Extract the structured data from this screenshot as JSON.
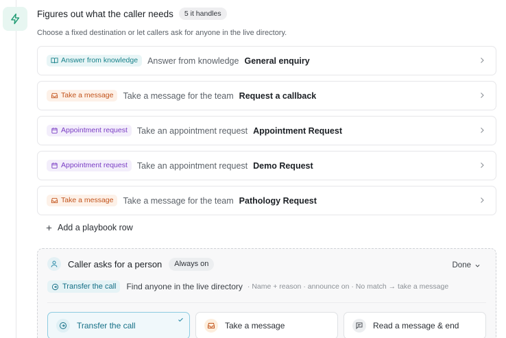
{
  "step": {
    "icon": "lightning-icon",
    "title": "Figures out what the caller needs",
    "handles_badge": "5 it handles",
    "subtitle": "Choose a fixed destination or let callers ask for anyone in the live directory."
  },
  "playbook_rows": [
    {
      "badge": "Answer from knowledge",
      "badge_icon": "book-icon",
      "tone": "teal",
      "description": "Answer from knowledge",
      "name": "General enquiry"
    },
    {
      "badge": "Take a message",
      "badge_icon": "inbox-icon",
      "tone": "orange",
      "description": "Take a message for the team",
      "name": "Request a callback"
    },
    {
      "badge": "Appointment request",
      "badge_icon": "calendar-icon",
      "tone": "purple",
      "description": "Take an appointment request",
      "name": "Appointment Request"
    },
    {
      "badge": "Appointment request",
      "badge_icon": "calendar-icon",
      "tone": "purple",
      "description": "Take an appointment request",
      "name": "Demo Request"
    },
    {
      "badge": "Take a message",
      "badge_icon": "inbox-icon",
      "tone": "orange",
      "description": "Take a message for the team",
      "name": "Pathology Request"
    }
  ],
  "add_row_label": "Add a playbook row",
  "person": {
    "title": "Caller asks for a person",
    "status_badge": "Always on",
    "done_label": "Done",
    "transfer_badge": "Transfer the call",
    "transfer_desc": "Find anyone in the live directory",
    "meta": "· Name + reason · announce on · No match → take a message",
    "options": [
      {
        "label": "Transfer the call",
        "icon": "transfer-icon",
        "selected": true
      },
      {
        "label": "Take a message",
        "icon": "inbox-icon",
        "selected": false
      },
      {
        "label": "Read a message & end",
        "icon": "message-icon",
        "selected": false
      }
    ]
  },
  "colors": {
    "accent_teal": "#17818a",
    "accent_orange": "#c2531b",
    "accent_purple": "#7a3dc4",
    "step_icon_green": "#1e9a72"
  }
}
